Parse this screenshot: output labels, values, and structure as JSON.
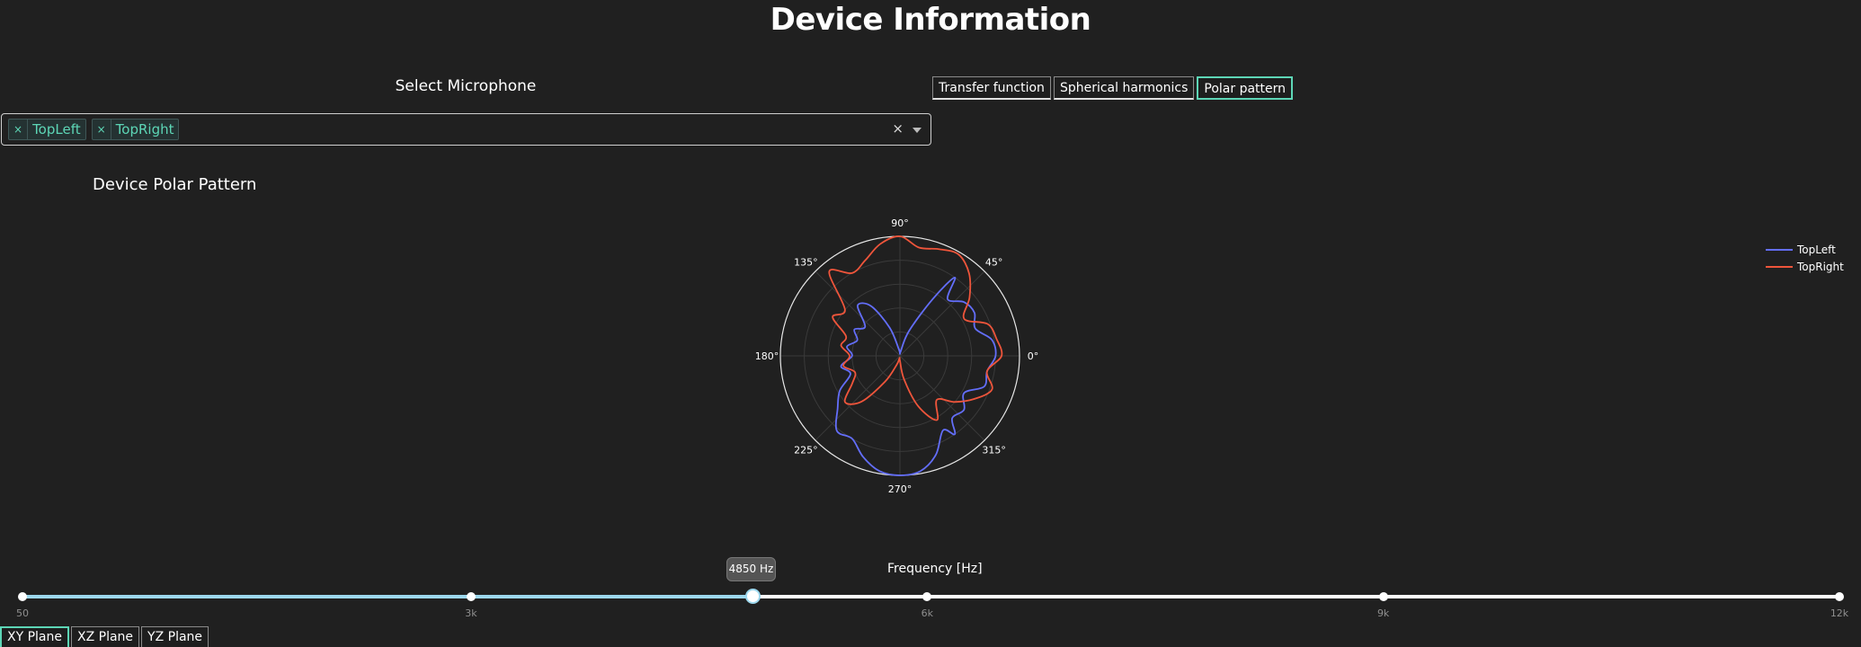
{
  "page": {
    "title": "Device Information"
  },
  "mic_select": {
    "label": "Select Microphone",
    "selected": [
      "TopLeft",
      "TopRight"
    ],
    "remove_symbol": "×",
    "clear_symbol": "×"
  },
  "view_tabs": [
    {
      "label": "Transfer function",
      "active": false
    },
    {
      "label": "Spherical harmonics",
      "active": false
    },
    {
      "label": "Polar pattern",
      "active": true
    }
  ],
  "chart": {
    "title": "Device Polar Pattern"
  },
  "chart_data": {
    "type": "line",
    "subtype": "polar",
    "angular_ticks": [
      "0°",
      "45°",
      "90°",
      "135°",
      "180°",
      "225°",
      "270°",
      "315°"
    ],
    "radial_range": [
      0,
      1
    ],
    "grid": true,
    "legend_placement": "top-right",
    "series": [
      {
        "name": "TopLeft",
        "color": "#636efa",
        "theta": [
          0,
          10,
          20,
          30,
          40,
          50,
          55,
          60,
          70,
          80,
          90,
          100,
          110,
          120,
          130,
          140,
          150,
          160,
          170,
          180,
          190,
          200,
          210,
          220,
          230,
          240,
          250,
          260,
          270,
          280,
          290,
          300,
          305,
          310,
          320,
          330,
          340,
          350
        ],
        "r": [
          0.8,
          0.78,
          0.67,
          0.72,
          0.7,
          0.62,
          0.8,
          0.55,
          0.22,
          0.04,
          0.02,
          0.06,
          0.25,
          0.48,
          0.55,
          0.38,
          0.44,
          0.38,
          0.45,
          0.4,
          0.5,
          0.44,
          0.58,
          0.68,
          0.82,
          0.8,
          0.9,
          0.98,
          1.0,
          0.98,
          0.88,
          0.72,
          0.8,
          0.68,
          0.7,
          0.62,
          0.75,
          0.74
        ]
      },
      {
        "name": "TopRight",
        "color": "#ef553b",
        "theta": [
          0,
          10,
          20,
          30,
          40,
          50,
          60,
          70,
          80,
          90,
          100,
          110,
          120,
          130,
          140,
          150,
          160,
          170,
          180,
          190,
          200,
          210,
          220,
          230,
          240,
          250,
          260,
          270,
          280,
          290,
          300,
          310,
          320,
          330,
          340,
          350
        ],
        "r": [
          0.85,
          0.82,
          0.78,
          0.62,
          0.76,
          0.9,
          0.98,
          0.95,
          0.92,
          1.0,
          0.95,
          0.85,
          0.8,
          0.92,
          0.6,
          0.65,
          0.48,
          0.5,
          0.42,
          0.48,
          0.4,
          0.46,
          0.6,
          0.5,
          0.25,
          0.08,
          0.02,
          0.04,
          0.2,
          0.45,
          0.62,
          0.48,
          0.6,
          0.72,
          0.82,
          0.74
        ]
      }
    ]
  },
  "legend": {
    "items": [
      {
        "name": "TopLeft",
        "color": "#636efa"
      },
      {
        "name": "TopRight",
        "color": "#ef553b"
      }
    ]
  },
  "slider": {
    "label": "Frequency [Hz]",
    "min": 50,
    "max": 12000,
    "value": 4850,
    "value_label": "4850 Hz",
    "marks": [
      {
        "value": 50,
        "label": "50"
      },
      {
        "value": 3000,
        "label": "3k"
      },
      {
        "value": 6000,
        "label": "6k"
      },
      {
        "value": 9000,
        "label": "9k"
      },
      {
        "value": 12000,
        "label": "12k"
      }
    ]
  },
  "plane_tabs": [
    {
      "label": "XY Plane",
      "active": true
    },
    {
      "label": "XZ Plane",
      "active": false
    },
    {
      "label": "YZ Plane",
      "active": false
    }
  ]
}
